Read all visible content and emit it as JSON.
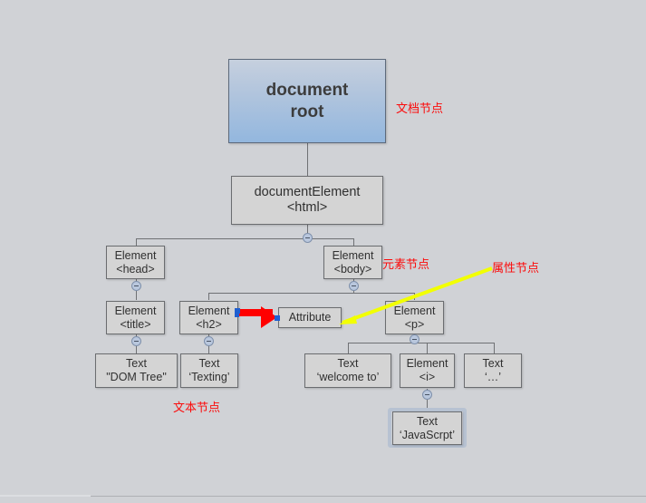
{
  "diagram": {
    "title_note": "DOM tree structure diagram",
    "nodes": {
      "root": {
        "line1": "document",
        "line2": "root"
      },
      "docel": {
        "line1": "documentElement",
        "line2": "<html>"
      },
      "head": {
        "line1": "Element",
        "line2": "<head>"
      },
      "body": {
        "line1": "Element",
        "line2": "<body>"
      },
      "title": {
        "line1": "Element",
        "line2": "<title>"
      },
      "h2": {
        "line1": "Element",
        "line2": "<h2>"
      },
      "attribute": {
        "line1": "Attribute",
        "line2": ""
      },
      "p": {
        "line1": "Element",
        "line2": "<p>"
      },
      "text_dom": {
        "line1": "Text",
        "line2": "\"DOM Tree\""
      },
      "text_texting": {
        "line1": "Text",
        "line2": "‘Texting’"
      },
      "text_welcome": {
        "line1": "Text",
        "line2": "‘welcome to’"
      },
      "elem_i": {
        "line1": "Element",
        "line2": "<i>"
      },
      "text_ellipsis": {
        "line1": "Text",
        "line2": "‘…’"
      },
      "text_js": {
        "line1": "Text",
        "line2": "‘JavaScrpt’"
      }
    },
    "annotations": {
      "document_node": "文档节点",
      "element_node": "元素节点",
      "attribute_node": "属性节点",
      "text_node": "文本节点"
    },
    "colors": {
      "background": "#d0d2d6",
      "node_fill": "#d4d4d4",
      "node_border": "#6b6d70",
      "root_gradient_top": "#c6d0de",
      "root_gradient_bottom": "#93b7de",
      "annotation_red": "#fb0b0b",
      "arrow_red": "#ff0000",
      "arrow_yellow": "#f2ff00",
      "connector_gray": "#6f7174",
      "handle_fill": "#b9c7dd",
      "selection_halo": "#b7c2d2"
    },
    "handles": {
      "label": "collapse",
      "glyph": "−"
    }
  }
}
